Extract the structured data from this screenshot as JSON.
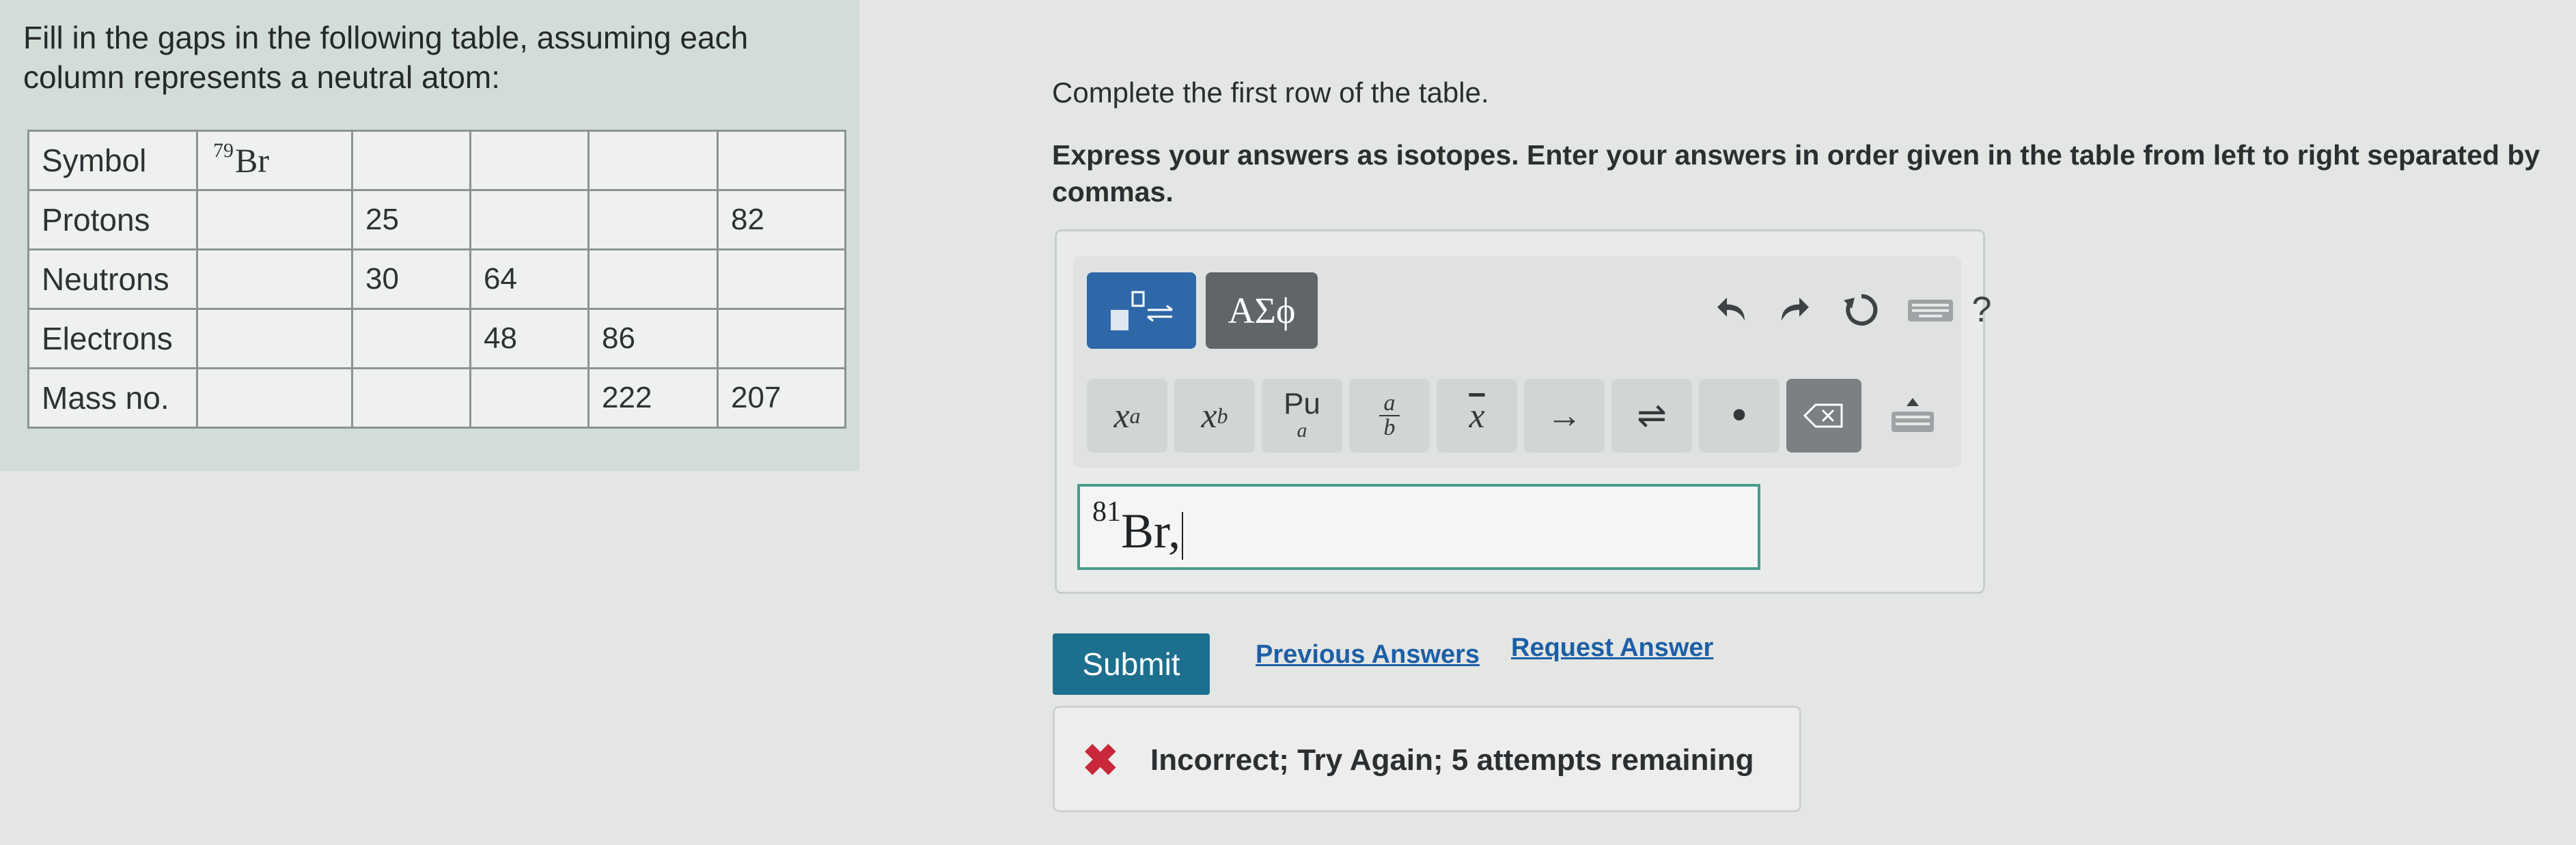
{
  "problem": {
    "text_line1": "Fill in the gaps in the following table, assuming each",
    "text_line2": "column represents a neutral atom:"
  },
  "table": {
    "rows": [
      {
        "label": "Symbol",
        "cells": [
          "",
          "",
          "",
          "",
          ""
        ],
        "first_isotope": {
          "mass": "79",
          "element": "Br"
        }
      },
      {
        "label": "Protons",
        "cells": [
          "",
          "25",
          "",
          "",
          "82"
        ]
      },
      {
        "label": "Neutrons",
        "cells": [
          "",
          "30",
          "64",
          "",
          ""
        ]
      },
      {
        "label": "Electrons",
        "cells": [
          "",
          "",
          "48",
          "86",
          ""
        ]
      },
      {
        "label": "Mass no.",
        "cells": [
          "",
          "",
          "",
          "222",
          "207"
        ]
      }
    ]
  },
  "question": {
    "instruction": "Complete the first row of the table.",
    "express": "Express your answers as isotopes. Enter your answers in order given in the table from left to right separated by commas."
  },
  "toolbar": {
    "greek_label": "ΑΣϕ",
    "help_label": "?",
    "templates": [
      {
        "id": "superscript",
        "label": "x",
        "sup": "a"
      },
      {
        "id": "subscript",
        "label": "x",
        "sub": "b"
      },
      {
        "id": "presub",
        "top": "Pu",
        "bottom": "a"
      },
      {
        "id": "fraction",
        "num": "a",
        "den": "b"
      },
      {
        "id": "overline",
        "label": "x"
      },
      {
        "id": "arrow",
        "label": "→"
      },
      {
        "id": "equilibrium",
        "label": "⇌"
      },
      {
        "id": "dot",
        "label": "•"
      }
    ]
  },
  "answer": {
    "mass": "81",
    "element": "Br",
    "trailing": ","
  },
  "actions": {
    "submit": "Submit",
    "previous_answers": "Previous Answers",
    "request_answer": "Request Answer"
  },
  "feedback": {
    "icon": "✖",
    "message": "Incorrect; Try Again; 5 attempts remaining"
  },
  "colors": {
    "submit": "#1d6f8e",
    "link": "#1d5fa6",
    "error": "#c8283a",
    "field_border": "#4a9c8c"
  }
}
